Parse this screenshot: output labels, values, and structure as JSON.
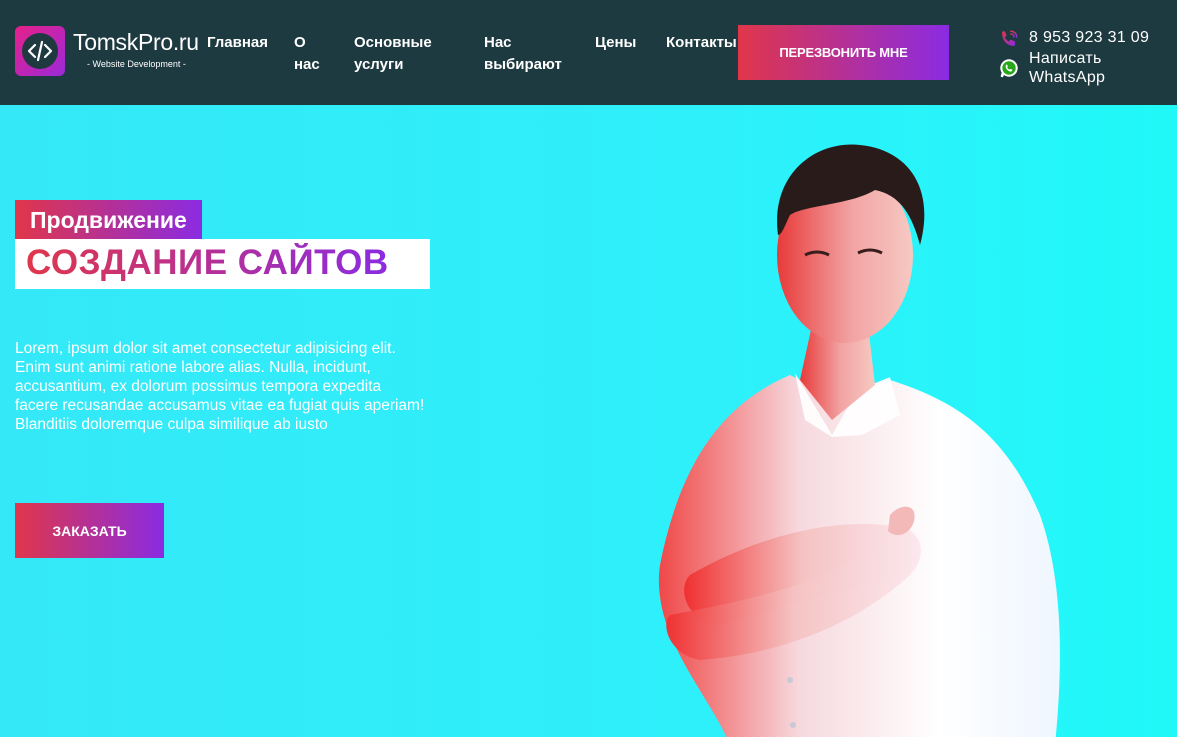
{
  "header": {
    "logo": {
      "title": "TomskPro.ru",
      "subtitle": "- Website Development -"
    },
    "nav": [
      {
        "label": "Главная"
      },
      {
        "label": "О нас"
      },
      {
        "label": "Основные услуги"
      },
      {
        "label": "Нас выбирают"
      },
      {
        "label": "Цены"
      },
      {
        "label": "Контакты"
      }
    ],
    "callback_button": "ПЕРЕЗВОНИТЬ МНЕ",
    "phone": "8 953 923 31 09",
    "whatsapp": "Написать WhatsApp"
  },
  "hero": {
    "tag": "Продвижение",
    "headline": "СОЗДАНИЕ САЙТОВ",
    "text": "Lorem, ipsum dolor sit amet consectetur adipisicing elit. Enim sunt animi ratione labore alias. Nulla, incidunt, accusantium, ex dolorum possimus tempora expedita facere recusandae accusamus vitae ea fugiat quis aperiam! Blanditiis doloremque culpa similique ab iusto",
    "order_button": "ЗАКАЗАТЬ"
  },
  "colors": {
    "header_bg": "#1d3a40",
    "hero_bg": "#2ef0fb",
    "gradient_start": "#e0364a",
    "gradient_end": "#8a2be2"
  },
  "icons": [
    "code-icon",
    "phone-icon",
    "whatsapp-icon"
  ]
}
